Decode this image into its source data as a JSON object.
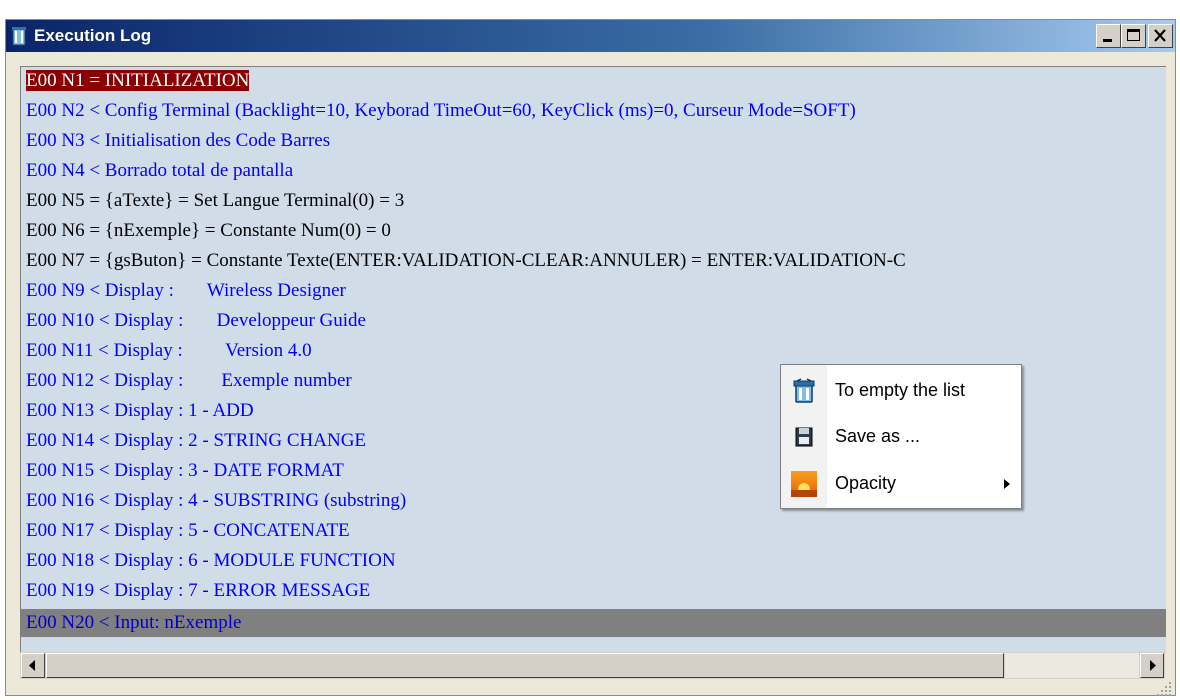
{
  "window": {
    "title": "Execution Log",
    "icons": {
      "app": "trash-bin-icon",
      "minimize": "minimize-icon",
      "maximize": "maximize-icon",
      "close": "close-icon"
    }
  },
  "log": {
    "rows": [
      {
        "text": "E00 N1 = INITIALIZATION",
        "color": "#ffffff",
        "style": "selected-red"
      },
      {
        "text": "E00 N2 < Config Terminal (Backlight=10, Keyborad TimeOut=60, KeyClick (ms)=0, Curseur Mode=SOFT)",
        "color": "#0000ff"
      },
      {
        "text": "E00 N3 < Initialisation des Code Barres",
        "color": "#0000ff"
      },
      {
        "text": "E00 N4 < Borrado total de pantalla",
        "color": "#0000ff"
      },
      {
        "text": "E00 N5 = {aTexte} = Set Langue Terminal(0) = 3",
        "color": "#000000"
      },
      {
        "text": "E00 N6 = {nExemple} = Constante Num(0) = 0",
        "color": "#000000"
      },
      {
        "text": "E00 N7 = {gsButon} = Constante Texte(ENTER:VALIDATION-CLEAR:ANNULER) = ENTER:VALIDATION-C",
        "color": "#000000"
      },
      {
        "text": "E00 N9 < Display :       Wireless Designer",
        "color": "#0000ff"
      },
      {
        "text": "E00 N10 < Display :       Developpeur Guide",
        "color": "#0000ff"
      },
      {
        "text": "E00 N11 < Display :         Version 4.0",
        "color": "#0000ff"
      },
      {
        "text": "E00 N12 < Display :        Exemple number",
        "color": "#0000ff"
      },
      {
        "text": "E00 N13 < Display : 1 - ADD",
        "color": "#0000ff"
      },
      {
        "text": "E00 N14 < Display : 2 - STRING CHANGE",
        "color": "#0000ff"
      },
      {
        "text": "E00 N15 < Display : 3 - DATE FORMAT",
        "color": "#0000ff"
      },
      {
        "text": "E00 N16 < Display : 4 - SUBSTRING (substring)",
        "color": "#0000ff"
      },
      {
        "text": "E00 N17 < Display : 5 - CONCATENATE",
        "color": "#0000ff"
      },
      {
        "text": "E00 N18 < Display : 6 - MODULE FUNCTION",
        "color": "#0000ff"
      },
      {
        "text": "E00 N19 < Display : 7 - ERROR MESSAGE",
        "color": "#0000ff"
      },
      {
        "text": "E00 N20 < Input: nExemple",
        "color": "#0000cc",
        "style": "current-gray"
      }
    ]
  },
  "context_menu": {
    "items": [
      {
        "label": "To empty the list",
        "icon": "trash-bin-icon"
      },
      {
        "label": "Save as ...",
        "icon": "floppy-disk-icon"
      },
      {
        "label": "Opacity",
        "icon": "sunset-icon",
        "submenu": true
      }
    ]
  },
  "scrollbar": {
    "left_icon": "scroll-left-arrow-icon",
    "right_icon": "scroll-right-arrow-icon"
  }
}
